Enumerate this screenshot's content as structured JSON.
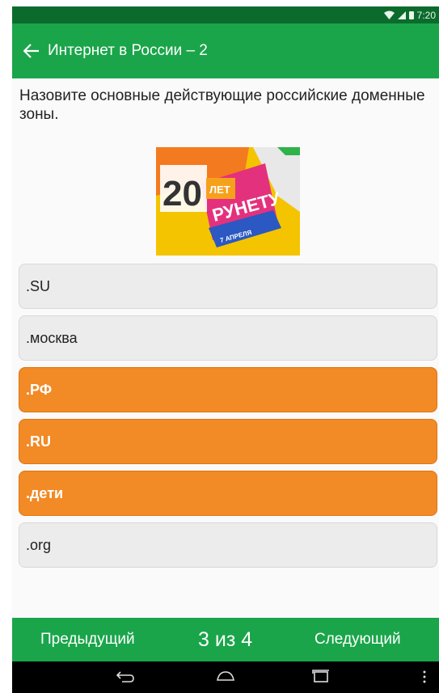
{
  "status_bar": {
    "time": "7:20"
  },
  "toolbar": {
    "title": "Интернет в России – 2"
  },
  "question": {
    "text": "Назовите основные действующие российские доменные зоны."
  },
  "image": {
    "big_number": "20",
    "word_top": "ЛЕТ",
    "word_main": "РУНЕТУ",
    "badge": "7 АПРЕЛЯ"
  },
  "answers": [
    {
      "label": ".SU",
      "selected": false
    },
    {
      "label": ".москва",
      "selected": false
    },
    {
      "label": ".РФ",
      "selected": true
    },
    {
      "label": ".RU",
      "selected": true
    },
    {
      "label": ".дети",
      "selected": true
    },
    {
      "label": ".org",
      "selected": false
    }
  ],
  "bottom": {
    "prev_label": "Предыдущий",
    "counter": "3 из 4",
    "next_label": "Следующий"
  },
  "colors": {
    "primary_green": "#1aa54a",
    "status_green": "#0b6b2d",
    "selected_orange": "#f28a25",
    "unselected_gray": "#ececec"
  }
}
